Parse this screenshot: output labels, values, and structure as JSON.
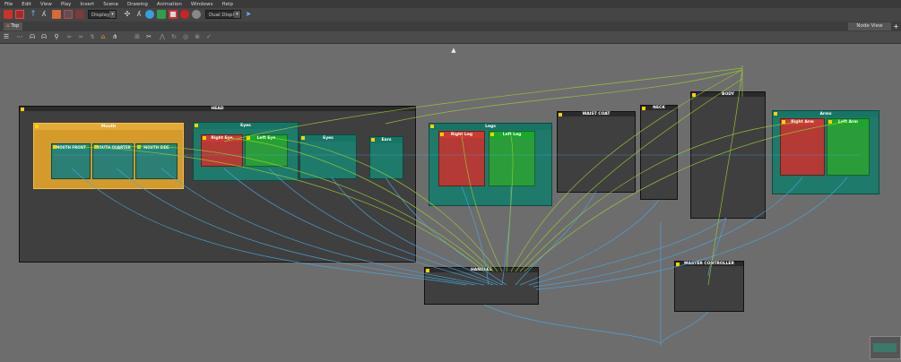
{
  "menu": [
    "File",
    "Edit",
    "View",
    "Play",
    "Insert",
    "Scene",
    "Drawing",
    "Animation",
    "Windows",
    "Help"
  ],
  "toolbar": {
    "display_dropdown": "Display",
    "display_dropdown2": "Dual Display",
    "icons": [
      "red-film-icon",
      "red-cube-icon",
      "pen-icon",
      "stroke-icon",
      "red-grid-icon",
      "brush-icon",
      "select-icon",
      "transform-icon",
      "globe-icon",
      "cursor-icon",
      "record-icon",
      "stop-icon",
      "gear-icon"
    ]
  },
  "tabs": {
    "top": "Top",
    "node_view": "Node View",
    "add": "+"
  },
  "groups": {
    "head": "HEAD",
    "mouth": "Mouth",
    "mouth_front": "MOUTH FRONT",
    "mouth_quarter": "MOUTH QUARTER",
    "mouth_side": "MOUTH SIDE",
    "eyes_outer": "Eyes",
    "right_eye": "Right Eye",
    "left_eye": "Left Eye",
    "eyes_inner": "Eyes",
    "ears": "Ears",
    "legs": "Legs",
    "right_leg": "Right Leg",
    "left_leg": "Left Leg",
    "waist_coat": "WAIST COAT",
    "neck": "NECK",
    "body": "BODY",
    "arms": "Arms",
    "right_arm": "Right Arm",
    "left_arm": "Left Arm",
    "handles": "HANDLES",
    "master_controller": "MASTER CONTROLLER"
  },
  "colors": {
    "wire_blue": "#4aa8e0",
    "wire_green": "#9acd32",
    "group_orange": "#d49a2a",
    "group_teal": "#1e7a6a",
    "group_red": "#b43a35",
    "group_green": "#2a9d3a",
    "group_dark": "#3f3f3f"
  }
}
